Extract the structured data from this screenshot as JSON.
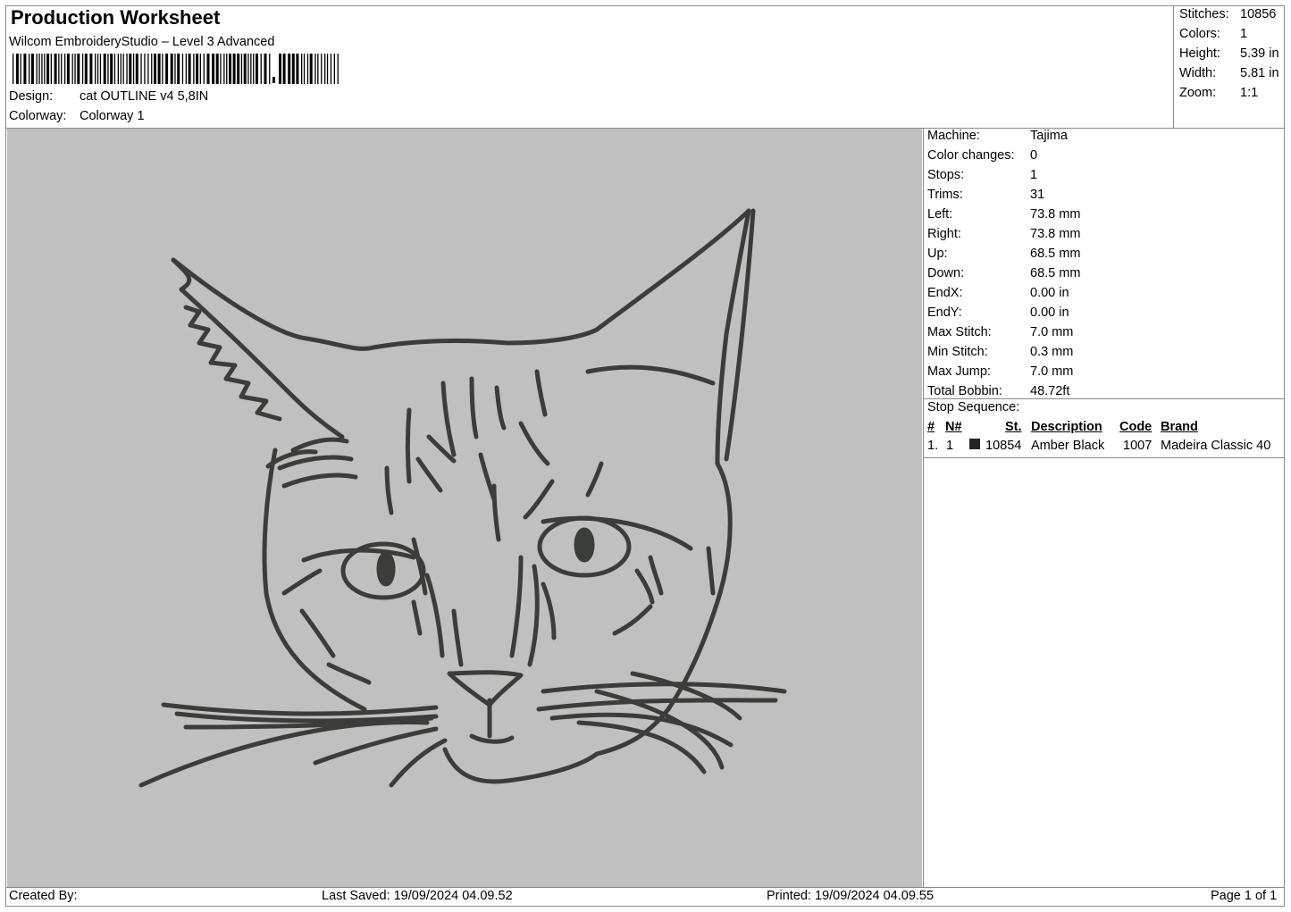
{
  "header": {
    "title": "Production Worksheet",
    "app": "Wilcom EmbroideryStudio – Level 3 Advanced",
    "design_label": "Design:",
    "design_value": "cat OUTLINE v4 5,8IN",
    "colorway_label": "Colorway:",
    "colorway_value": "Colorway 1"
  },
  "stats": [
    {
      "label": "Stitches:",
      "value": "10856"
    },
    {
      "label": "Colors:",
      "value": "1"
    },
    {
      "label": "Height:",
      "value": "5.39 in"
    },
    {
      "label": "Width:",
      "value": "5.81 in"
    },
    {
      "label": "Zoom:",
      "value": "1:1"
    }
  ],
  "info": [
    {
      "label": "Machine:",
      "value": "Tajima"
    },
    {
      "label": "Color changes:",
      "value": "0"
    },
    {
      "label": "Stops:",
      "value": "1"
    },
    {
      "label": "Trims:",
      "value": "31"
    },
    {
      "label": "Left:",
      "value": "73.8 mm"
    },
    {
      "label": "Right:",
      "value": "73.8 mm"
    },
    {
      "label": "Up:",
      "value": "68.5 mm"
    },
    {
      "label": "Down:",
      "value": "68.5 mm"
    },
    {
      "label": "EndX:",
      "value": "0.00 in"
    },
    {
      "label": "EndY:",
      "value": "0.00 in"
    },
    {
      "label": "Max Stitch:",
      "value": "7.0 mm"
    },
    {
      "label": "Min Stitch:",
      "value": "0.3 mm"
    },
    {
      "label": "Max Jump:",
      "value": "7.0 mm"
    },
    {
      "label": "Total Bobbin:",
      "value": "48.72ft"
    }
  ],
  "stop_sequence": {
    "title": "Stop Sequence:",
    "headers": {
      "num": "#",
      "n": "N#",
      "st": "St.",
      "description": "Description",
      "code": "Code",
      "brand": "Brand"
    },
    "rows": [
      {
        "num": "1.",
        "n": "1",
        "color": "#262626",
        "st": "10854",
        "description": "Amber Black",
        "code": "1007",
        "brand": "Madeira Classic 40"
      }
    ]
  },
  "design_preview": {
    "background": "#c0c0c0",
    "thread_color": "#3b3d39"
  },
  "footer": {
    "created_by": "Created By:",
    "last_saved": "Last Saved: 19/09/2024 04.09.52",
    "printed": "Printed: 19/09/2024 04.09.55",
    "page": "Page 1 of 1"
  }
}
